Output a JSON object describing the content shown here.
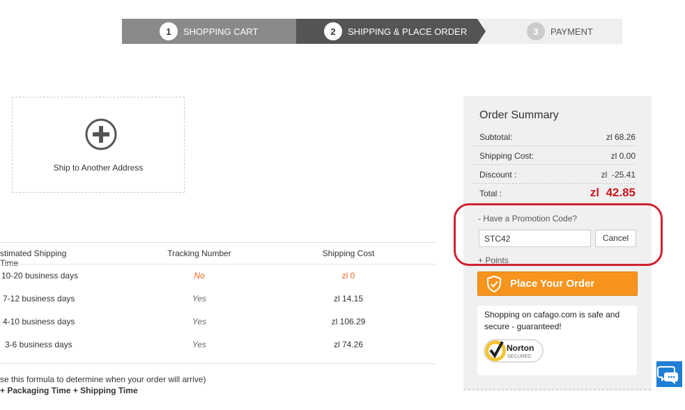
{
  "steps": [
    {
      "num": "1",
      "label": "SHOPPING CART"
    },
    {
      "num": "2",
      "label": "SHIPPING & PLACE ORDER"
    },
    {
      "num": "3",
      "label": "PAYMENT"
    }
  ],
  "address": {
    "label": "Ship to Another Address",
    "icon": "plus-circle-icon"
  },
  "shipping_table": {
    "headers": [
      "stimated Shipping Time",
      "Tracking Number",
      "Shipping Cost"
    ],
    "rows": [
      {
        "time": "10-20 business days",
        "tracking": "No",
        "cost": "zl 0"
      },
      {
        "time": "7-12 business days",
        "tracking": "Yes",
        "cost": "zl 14.15"
      },
      {
        "time": "4-10 business days",
        "tracking": "Yes",
        "cost": "zl 106.29"
      },
      {
        "time": "3-6 business days",
        "tracking": "Yes",
        "cost": "zl 74.26"
      }
    ],
    "note_line1": "se this formula to determine when your order will arrive)",
    "note_line2": "+ Packaging Time + Shipping Time"
  },
  "summary": {
    "title": "Order Summary",
    "subtotal_label": "Subtotal:",
    "subtotal_value": "zl 68.26",
    "shipping_label": "Shipping Cost:",
    "shipping_value": "zl 0.00",
    "discount_label": "Discount :",
    "discount_value": "zl  -25.41",
    "total_label": "Total :",
    "total_value": "zl  42.85",
    "promo_label": "-  Have a Promotion Code?",
    "promo_value": "STC42",
    "cancel_label": "Cancel",
    "points_label": "+ Points",
    "place_order_label": "Place Your Order",
    "safe_text": "Shopping on cafago.com is safe and secure - guaranteed!",
    "norton_brand": "Norton",
    "norton_sub": "SECURED"
  },
  "colors": {
    "accent": "#f7941d",
    "total": "#c9171e",
    "highlight_circle": "#d0202e",
    "chat": "#1e7fd4"
  }
}
